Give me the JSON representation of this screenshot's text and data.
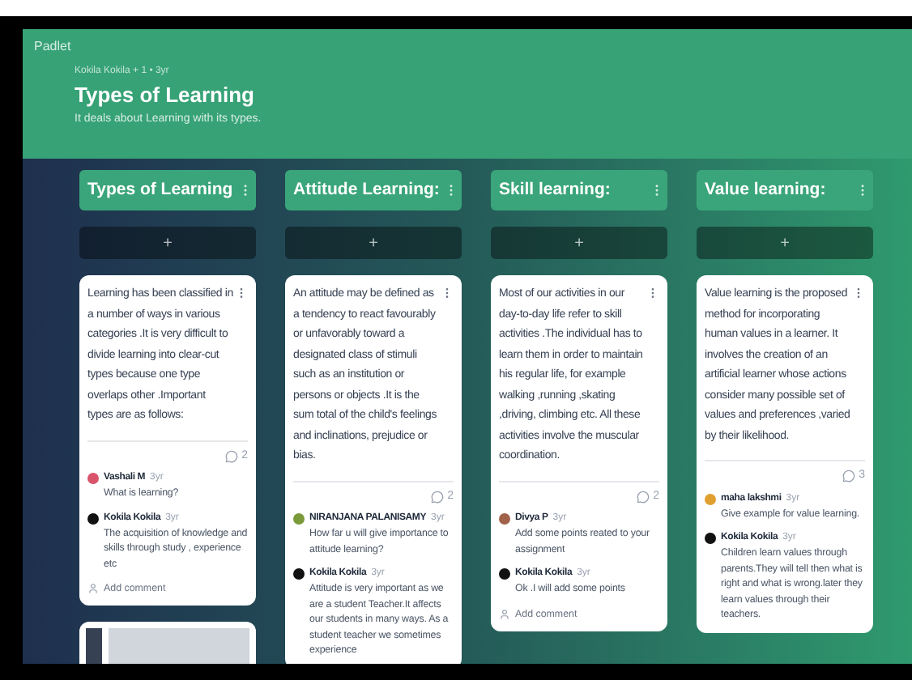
{
  "app": {
    "logo": "Padlet"
  },
  "header": {
    "byline": "Kokila Kokila + 1 • 3yr",
    "title": "Types of Learning",
    "description": "It deals about Learning with its types."
  },
  "columns": [
    {
      "title": "Types of Learning",
      "add_label": "+",
      "post": {
        "text": "Learning has been classified in a number of ways in various categories .It is very difficult to divide learning into clear-cut types because one type  overlaps other .Important types are as follows:",
        "comment_count": "2",
        "comments": [
          {
            "author": "Vashali M",
            "time": "3yr",
            "text": "What is learning?",
            "color": "#d9546a"
          },
          {
            "author": "Kokila Kokila",
            "time": "3yr",
            "text": "The acquisition of knowledge and skills through study , experience etc",
            "color": "#111111"
          }
        ],
        "add_comment": "Add comment"
      },
      "more_posts": [
        {
          "kind": "image"
        }
      ]
    },
    {
      "title": "Attitude Learning:",
      "add_label": "+",
      "post": {
        "text": "An attitude may be defined as a tendency to react favourably or unfavorably toward a designated class of stimuli such as an institution or persons or objects .It is the sum total of the child's feelings and inclinations, prejudice or bias.",
        "comment_count": "2",
        "comments": [
          {
            "author": "NIRANJANA PALANISAMY",
            "time": "3yr",
            "text": "How far u will give importance to attitude learning?",
            "color": "#7a9a3a"
          },
          {
            "author": "Kokila Kokila",
            "time": "3yr",
            "text": "Attitude is very important as we are a student Teacher.It affects our students in many ways. As a student teacher we sometimes experience",
            "color": "#111111"
          }
        ]
      }
    },
    {
      "title": "Skill learning:",
      "add_label": "+",
      "post": {
        "text": "Most of our activities in our day-to-day  life refer to skill activities .The individual has to learn them in order to maintain his regular life, for example walking ,running ,skating ,driving, climbing etc. All these activities involve the muscular coordination.",
        "comment_count": "2",
        "comments": [
          {
            "author": "Divya P",
            "time": "3yr",
            "text": "Add some points reated to your assignment",
            "color": "#a0634a"
          },
          {
            "author": "Kokila Kokila",
            "time": "3yr",
            "text": "Ok .I will add some points",
            "color": "#111111"
          }
        ],
        "add_comment": "Add comment"
      }
    },
    {
      "title": "Value learning:",
      "add_label": "+",
      "post": {
        "text": "Value learning is the proposed method for incorporating human values in a learner. It involves the creation of an artificial learner whose actions consider many possible set of values and preferences ,varied by their likelihood.",
        "comment_count": "3",
        "comments": [
          {
            "author": "maha lakshmi",
            "time": "3yr",
            "text": "Give example for value learning.",
            "color": "#e0a030"
          },
          {
            "author": "Kokila Kokila",
            "time": "3yr",
            "text": "Children learn values through parents.They will tell then what is right and what is wrong.later they learn values through their teachers.",
            "color": "#111111"
          }
        ]
      }
    }
  ]
}
